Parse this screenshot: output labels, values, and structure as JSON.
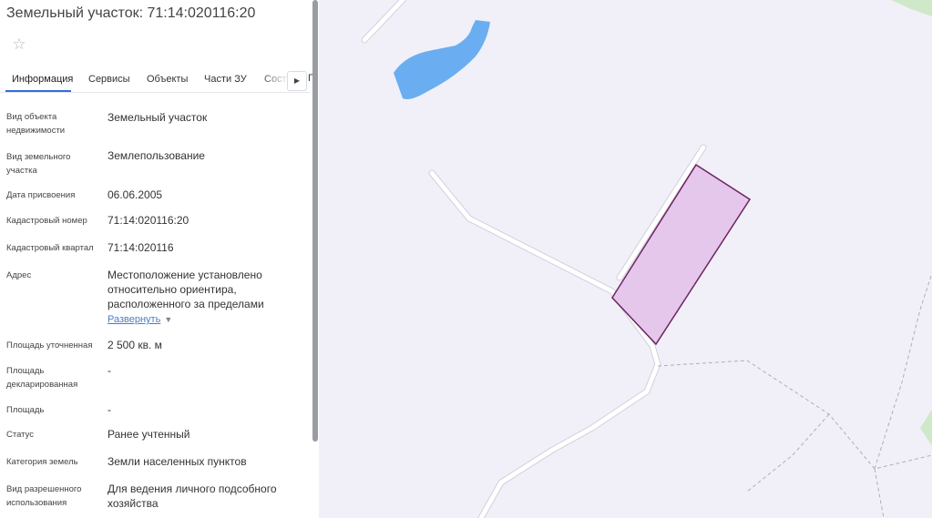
{
  "panel": {
    "title": "Земельный участок: 71:14:020116:20",
    "tabs": [
      "Информация",
      "Сервисы",
      "Объекты",
      "Части ЗУ",
      "Соста"
    ],
    "tab_clip": "П",
    "fields": [
      {
        "label": "Вид объекта недвижимости",
        "value": "Земельный участок"
      },
      {
        "label": "Вид земельного участка",
        "value": "Землепользование"
      },
      {
        "label": "Дата присвоения",
        "value": "06.06.2005"
      },
      {
        "label": "Кадастровый номер",
        "value": "71:14:020116:20"
      },
      {
        "label": "Кадастровый квартал",
        "value": "71:14:020116"
      },
      {
        "label": "Адрес",
        "value": "Местоположение установлено относительно ориентира, расположенного за пределами"
      },
      {
        "label": "Площадь уточненная",
        "value": "2 500 кв. м"
      },
      {
        "label": "Площадь декларированная",
        "value": "-"
      },
      {
        "label": "Площадь",
        "value": "-"
      },
      {
        "label": "Статус",
        "value": "Ранее учтенный"
      },
      {
        "label": "Категория земель",
        "value": "Земли населенных пунктов"
      },
      {
        "label": "Вид разрешенного использования",
        "value": "Для ведения личного подсобного хозяйства"
      }
    ],
    "expand_link": "Развернуть"
  },
  "icons": {
    "favorite": "star-icon",
    "tab_scroll": "arrow-right-icon",
    "expand": "chevron-down-icon"
  },
  "colors": {
    "accent": "#2f6fd6",
    "parcel_fill": "#e6c7ec",
    "parcel_stroke": "#6e2361",
    "water": "#6aaef1",
    "link": "#4a7dc6"
  }
}
